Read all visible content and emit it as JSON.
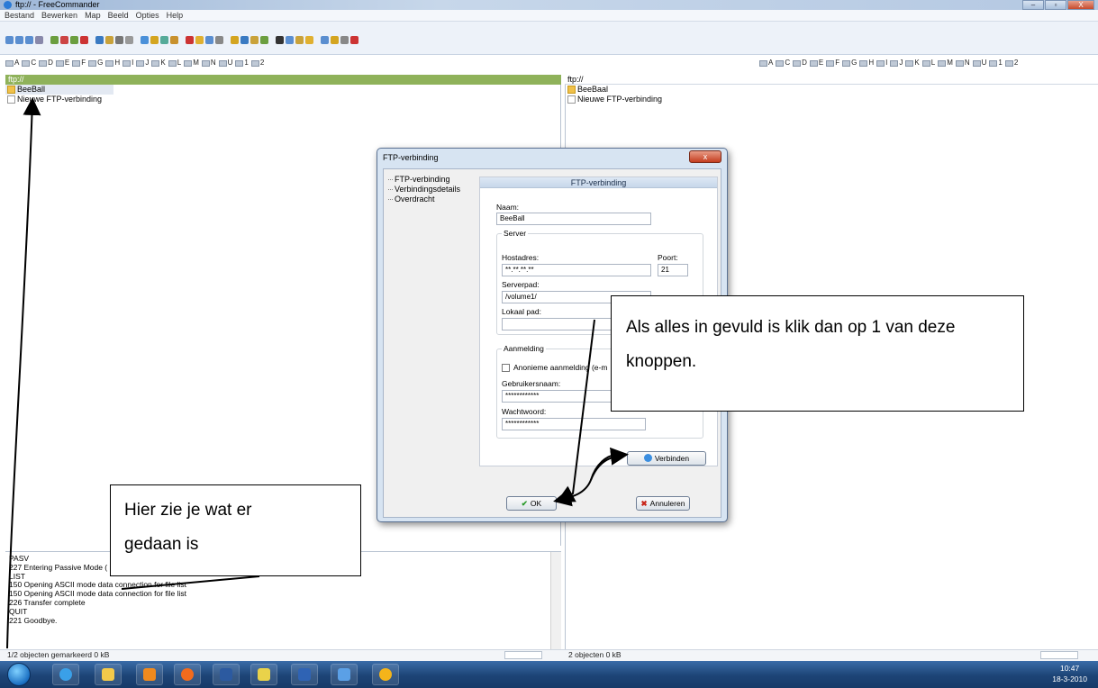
{
  "window": {
    "title": "ftp:// - FreeCommander",
    "buttons": [
      "–",
      "▫",
      "X"
    ]
  },
  "menu": [
    "Bestand",
    "Bewerken",
    "Map",
    "Beeld",
    "Opties",
    "Help"
  ],
  "drives_left": [
    "A",
    "C",
    "D",
    "E",
    "F",
    "G",
    "H",
    "I",
    "J",
    "K",
    "L",
    "M",
    "N",
    "U",
    "1",
    "2"
  ],
  "drives_right": [
    "A",
    "C",
    "D",
    "E",
    "F",
    "G",
    "H",
    "I",
    "J",
    "K",
    "L",
    "M",
    "N",
    "U",
    "1",
    "2"
  ],
  "left_panel": {
    "path": "ftp://",
    "items": [
      {
        "name": "BeeBall",
        "type": "folder",
        "selected": true
      },
      {
        "name": "Nieuwe FTP-verbinding",
        "type": "file",
        "selected": false
      }
    ],
    "status": "1/2 objecten gemarkeerd  0 kB"
  },
  "right_panel": {
    "path": "ftp://",
    "items": [
      {
        "name": "BeeBaal",
        "type": "folder"
      },
      {
        "name": "Nieuwe FTP-verbinding",
        "type": "file"
      }
    ],
    "status": "2 objecten  0 kB"
  },
  "log": {
    "lines": [
      "PASV",
      "227 Entering Passive Mode (",
      "LIST",
      "150 Opening ASCII mode data connection for file list",
      "150 Opening ASCII mode data connection for file list",
      "226 Transfer complete",
      "QUIT",
      "221 Goodbye."
    ]
  },
  "dialog": {
    "title": "FTP-verbinding",
    "close_label": "x",
    "tree": [
      "FTP-verbinding",
      "Verbindingsdetails",
      "Overdracht"
    ],
    "section_title": "FTP-verbinding",
    "name_label": "Naam:",
    "name_value": "BeeBall",
    "server_group": "Server",
    "host_label": "Hostadres:",
    "host_value": "**.**.**.**",
    "port_label": "Poort:",
    "port_value": "21",
    "serverpath_label": "Serverpad:",
    "serverpath_value": "/volume1/",
    "localpath_label": "Lokaal pad:",
    "localpath_value": "",
    "login_group": "Aanmelding",
    "anon_label": "Anonieme aanmelding (e-m",
    "user_label": "Gebruikersnaam:",
    "user_value": "************",
    "pass_label": "Wachtwoord:",
    "pass_value": "************",
    "connect_label": "Verbinden",
    "ok_label": "OK",
    "cancel_label": "Annuleren"
  },
  "callouts": {
    "right": "Als alles in gevuld is klik dan op 1 van deze knoppen.",
    "left_line1": "Hier zie je wat er",
    "left_line2": "gedaan is"
  },
  "clock": {
    "time": "10:47",
    "date": "18-3-2010"
  }
}
